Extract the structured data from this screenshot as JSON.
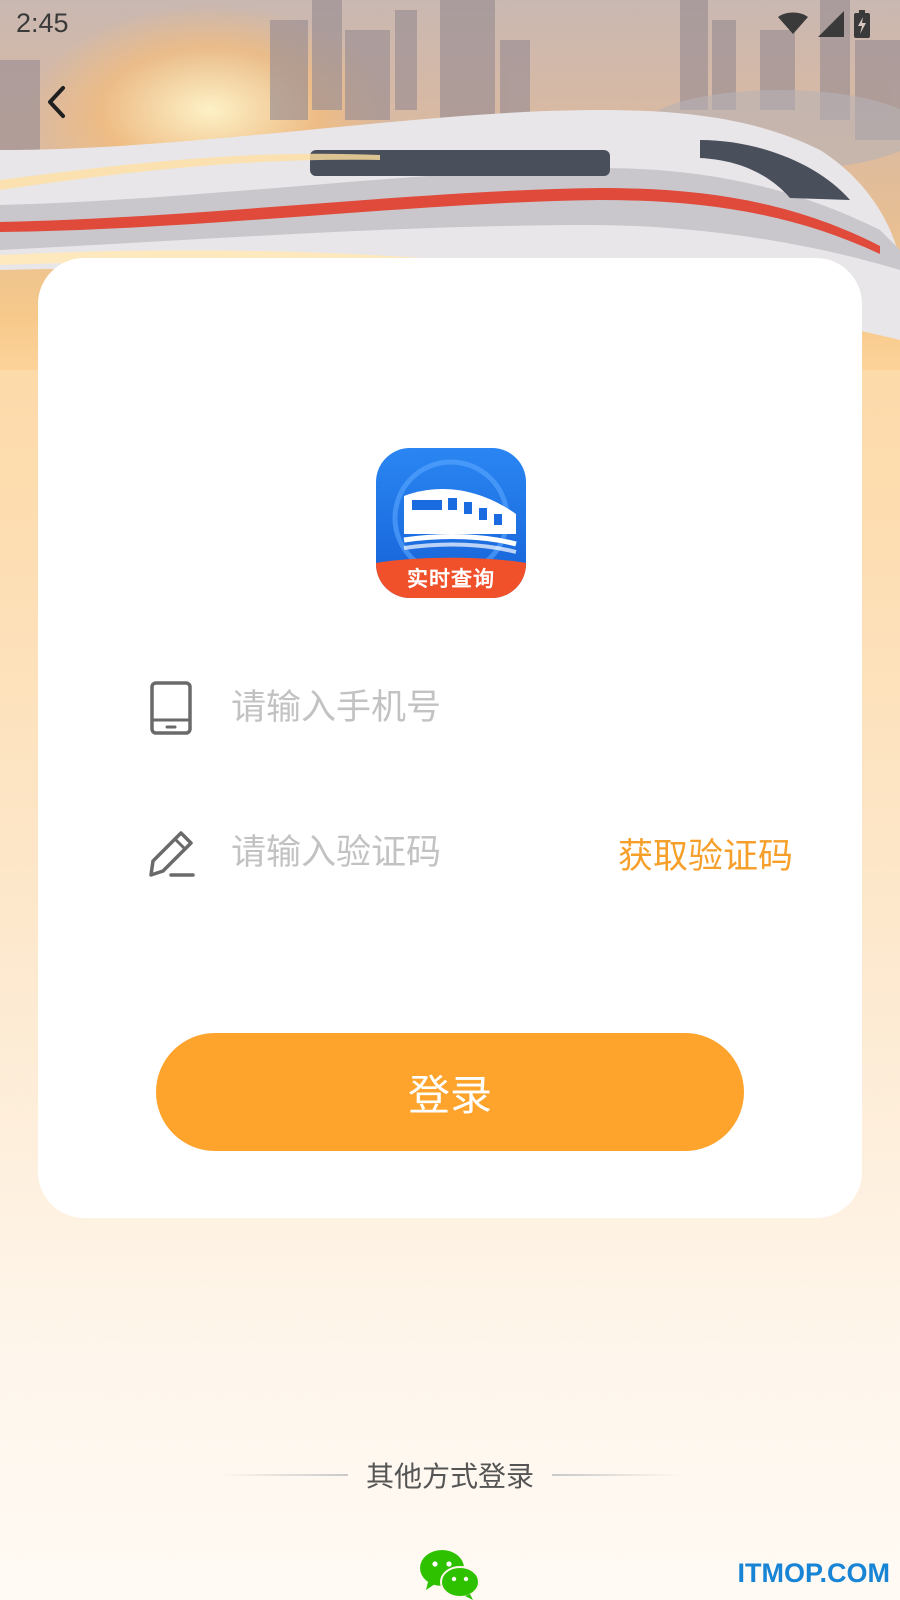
{
  "status_bar": {
    "time": "2:45",
    "icons": [
      "wifi-icon",
      "signal-icon",
      "battery-icon"
    ]
  },
  "header": {
    "back_icon": "chevron-left-icon"
  },
  "logo": {
    "badge_text": "实时查询",
    "colors": {
      "primary": "#1f74e8",
      "badge": "#f0502a"
    }
  },
  "form": {
    "phone": {
      "icon": "phone-icon",
      "placeholder": "请输入手机号",
      "value": ""
    },
    "code": {
      "icon": "pencil-icon",
      "placeholder": "请输入验证码",
      "value": "",
      "get_code_label": "获取验证码"
    },
    "login_label": "登录"
  },
  "other_login": {
    "label": "其他方式登录",
    "methods": [
      "wechat-icon"
    ]
  },
  "watermark": "ITMOP.COM",
  "colors": {
    "accent": "#fea32c",
    "accent_text": "#f6a02b",
    "card": "#ffffff"
  }
}
